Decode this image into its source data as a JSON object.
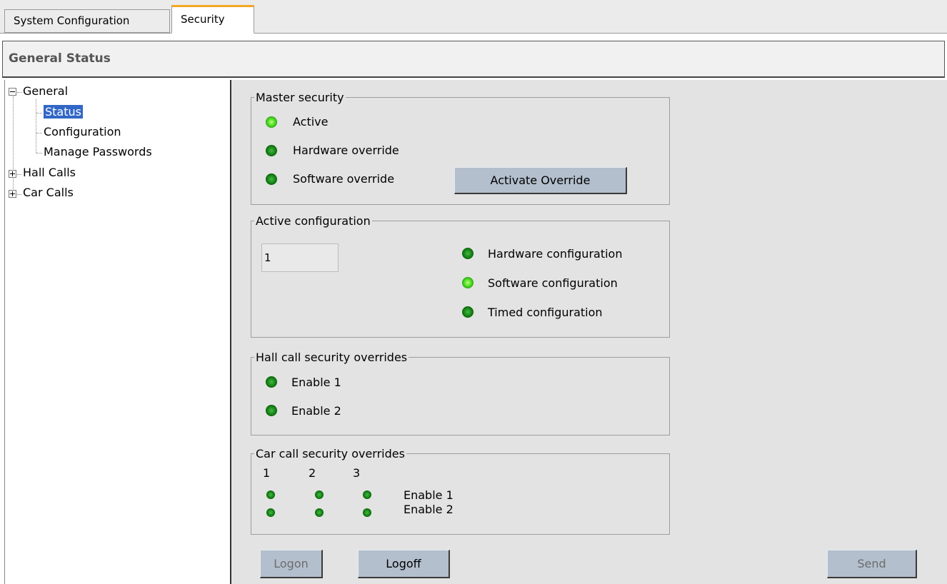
{
  "tabs": [
    {
      "label": "System Configuration"
    },
    {
      "label": "Security"
    }
  ],
  "header": {
    "title": "General Status"
  },
  "tree": {
    "general": "General",
    "status": "Status",
    "configuration": "Configuration",
    "manage_passwords": "Manage Passwords",
    "hall_calls": "Hall Calls",
    "car_calls": "Car Calls"
  },
  "master_security": {
    "legend": "Master security",
    "active": "Active",
    "hardware_override": "Hardware override",
    "software_override": "Software override",
    "activate_override_button": "Activate Override"
  },
  "active_configuration": {
    "legend": "Active configuration",
    "value": "1",
    "hardware": "Hardware configuration",
    "software": "Software configuration",
    "timed": "Timed configuration"
  },
  "hall_call": {
    "legend": "Hall call security overrides",
    "enable1": "Enable 1",
    "enable2": "Enable 2"
  },
  "car_call": {
    "legend": "Car call security overrides",
    "col1": "1",
    "col2": "2",
    "col3": "3",
    "enable1": "Enable 1",
    "enable2": "Enable 2"
  },
  "buttons": {
    "logon": "Logon",
    "logoff": "Logoff",
    "send": "Send"
  },
  "leds": {
    "active": "on",
    "hardware_override": "off",
    "software_override": "off",
    "hardware_configuration": "off",
    "software_configuration": "on",
    "timed_configuration": "off"
  },
  "colors": {
    "accent_tab": "#f5a623",
    "selection": "#3167c6",
    "button": "#b3bfcd"
  }
}
